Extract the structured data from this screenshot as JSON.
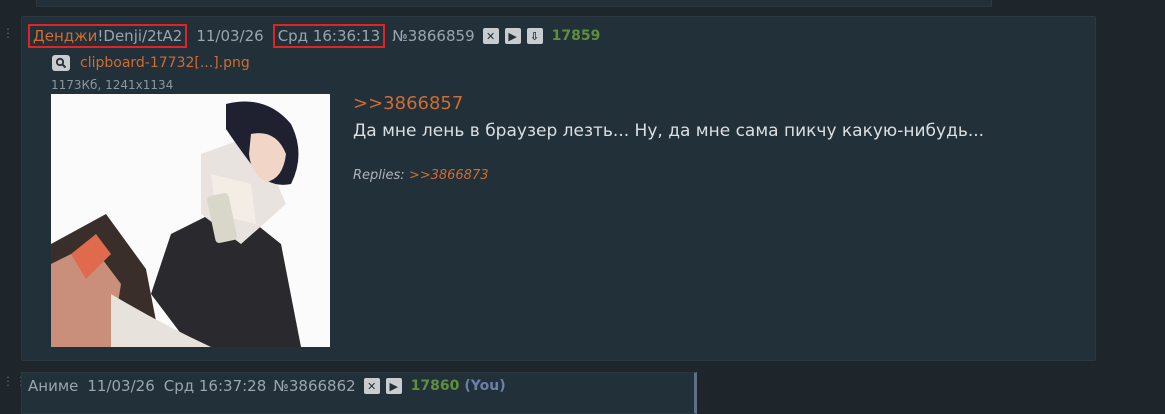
{
  "post": {
    "name": "Денджи",
    "trip": "!Denji/2tA2",
    "date": "11/03/26",
    "time": "Срд 16:36:13",
    "number": "№3866859",
    "count": "17859",
    "file": {
      "name": "clipboard-17732[...].png",
      "info": "1173Кб, 1241x1134"
    },
    "reply_link": ">>3866857",
    "message": "Да мне лень в браузер лезть... Ну, да мне сама пикчу какую-нибудь...",
    "replies_label": "Replies:",
    "replies": [
      ">>3866873"
    ]
  },
  "post2": {
    "name": "Аниме",
    "date": "11/03/26",
    "time": "Срд 16:37:28",
    "number": "№3866862",
    "count": "17860",
    "you": "(You)"
  },
  "colors": {
    "background": "#1e262c",
    "post_background": "#22303a",
    "link": "#cf6c33",
    "counter": "#5f8e3d",
    "highlight_box": "#e02424"
  },
  "icons": [
    "hide-icon",
    "play-icon",
    "download-icon",
    "search-icon"
  ]
}
